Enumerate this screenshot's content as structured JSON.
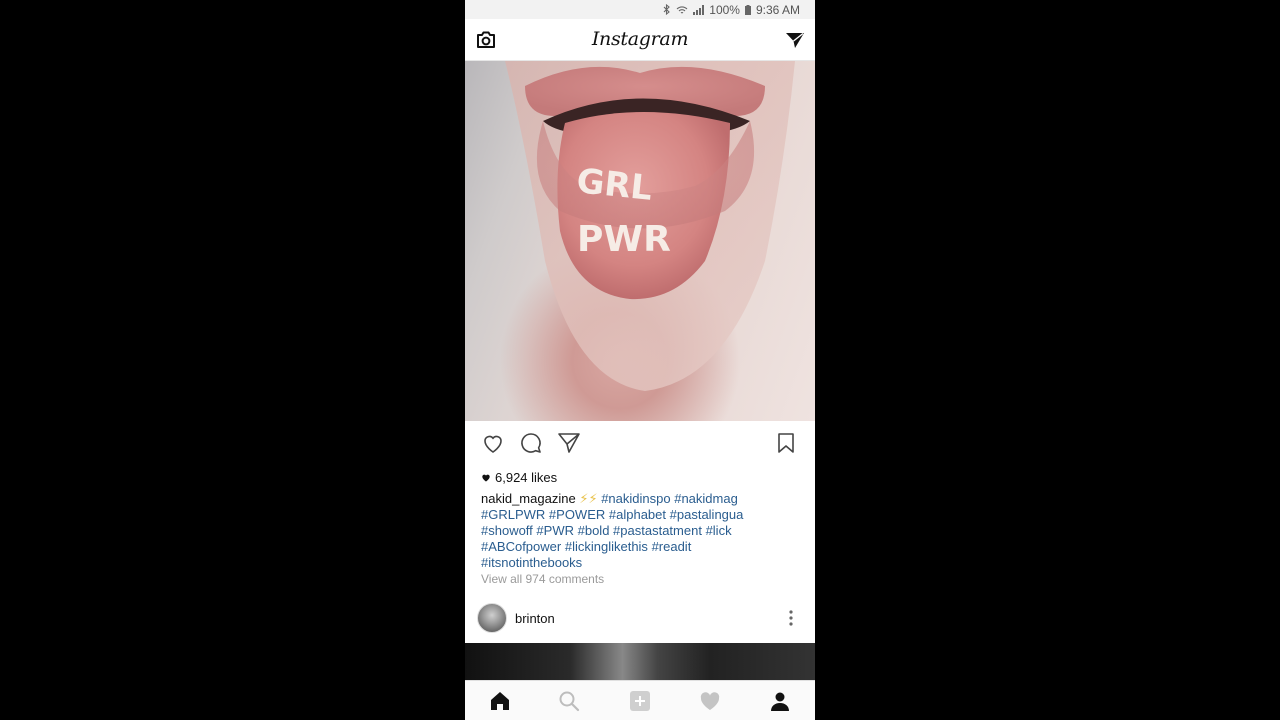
{
  "statusbar": {
    "battery": "100%",
    "time": "9:36 AM"
  },
  "header": {
    "logo": "Instagram",
    "left_icon": "camera-icon",
    "right_icon": "direct-send-icon"
  },
  "post": {
    "image_text": [
      "GRL",
      "PWR"
    ],
    "likes": "6,924 likes",
    "username": "nakid_magazine",
    "emoji": "⚡⚡",
    "hashtags": [
      "#nakidinspo",
      "#nakidmag",
      "#GRLPWR",
      "#POWER",
      "#alphabet",
      "#pastalingua",
      "#showoff",
      "#PWR",
      "#bold",
      "#pastastatment",
      "#lick",
      "#ABCofpower",
      "#lickinglikethis",
      "#readit",
      "#itsnotinthebooks"
    ],
    "view_comments": "View all 974 comments"
  },
  "next_post": {
    "username": "brinton"
  },
  "tabbar": {
    "items": [
      "home-icon",
      "search-icon",
      "add-icon",
      "heart-icon",
      "profile-icon"
    ]
  }
}
